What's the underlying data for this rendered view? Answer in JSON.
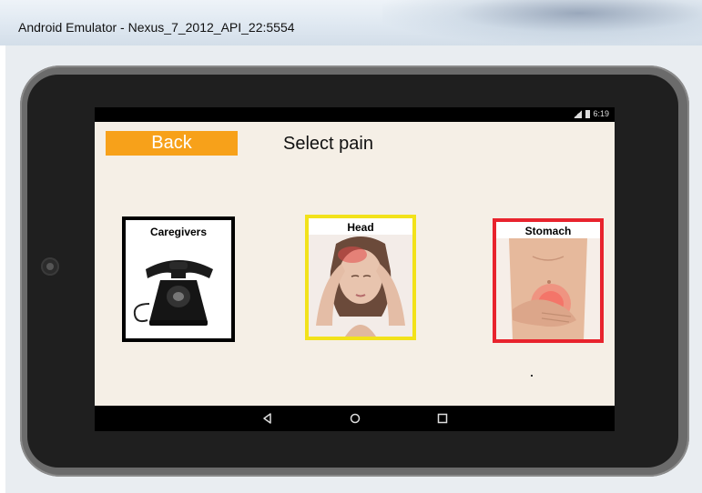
{
  "window": {
    "title": "Android Emulator - Nexus_7_2012_API_22:5554"
  },
  "status_bar": {
    "time": "6:19",
    "icons": [
      "signal-icon",
      "battery-icon"
    ]
  },
  "app": {
    "back_label": "Back",
    "title": "Select pain",
    "cards": [
      {
        "label": "Caregivers",
        "icon": "telephone-icon",
        "border_color": "#000000"
      },
      {
        "label": "Head",
        "icon": "headache-image",
        "border_color": "#f2e21a"
      },
      {
        "label": "Stomach",
        "icon": "stomach-image",
        "border_color": "#e8232d"
      }
    ]
  },
  "nav_bar": {
    "buttons": [
      "back-icon",
      "home-icon",
      "recents-icon"
    ]
  },
  "colors": {
    "back_button": "#f7a11a",
    "app_background": "#f5efe6",
    "device_frame": "#6b6b6b"
  }
}
